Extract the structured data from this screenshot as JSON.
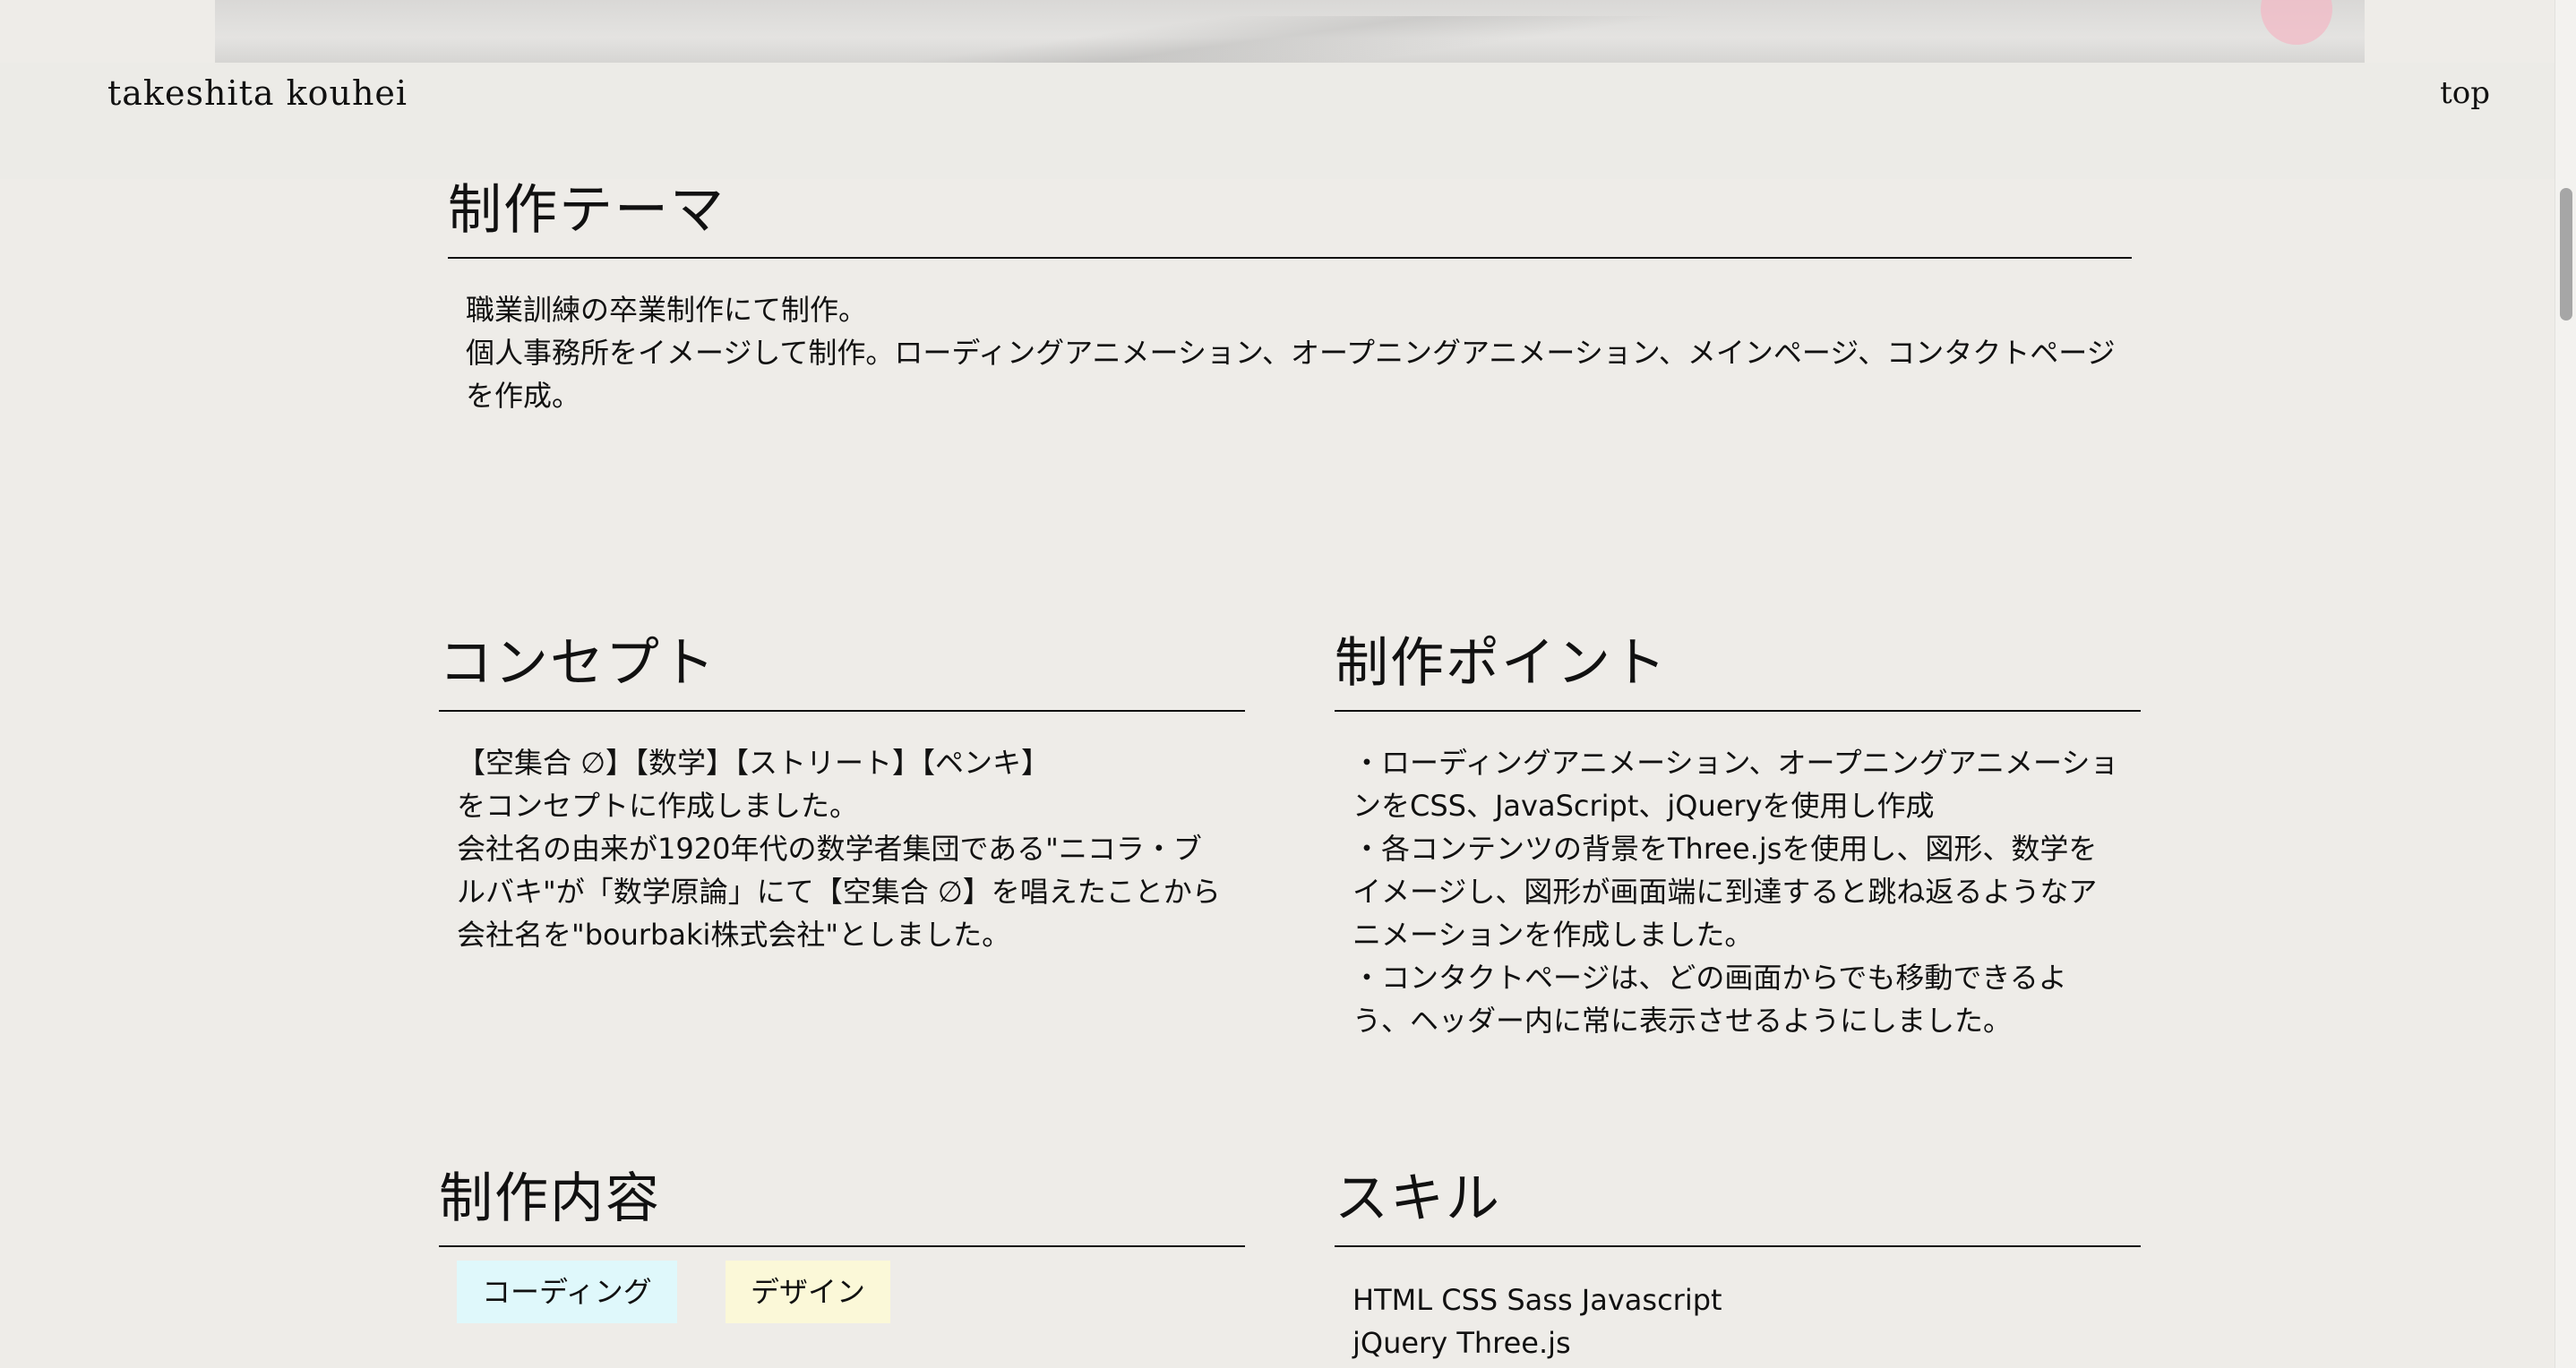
{
  "header": {
    "site_title": "takeshita kouhei",
    "nav_top": "top"
  },
  "theme": {
    "heading": "制作テーマ",
    "lines": [
      "職業訓練の卒業制作にて制作。",
      "個人事務所をイメージして制作。ローディングアニメーション、オープニングアニメーション、メインページ、コンタクトページ",
      "を作成。"
    ]
  },
  "concept": {
    "heading": "コンセプト",
    "lines": [
      "【空集合 ∅】【数学】【ストリート】【ペンキ】",
      "をコンセプトに作成しました。",
      "会社名の由来が1920年代の数学者集団である\"ニコラ・ブ",
      "ルバキ\"が「数学原論」にて【空集合 ∅】を唱えたことから",
      "会社名を\"bourbaki株式会社\"としました。"
    ]
  },
  "points": {
    "heading": "制作ポイント",
    "lines": [
      "・ローディングアニメーション、オープニングアニメーショ",
      "ンをCSS、JavaScript、jQueryを使用し作成",
      "・各コンテンツの背景をThree.jsを使用し、図形、数学を",
      "イメージし、図形が画面端に到達すると跳ね返るようなア",
      "ニメーションを作成しました。",
      "・コンタクトページは、どの画面からでも移動できるよ",
      "う、ヘッダー内に常に表示させるようにしました。"
    ]
  },
  "contents": {
    "heading": "制作内容",
    "tags": [
      "コーディング",
      "デザイン"
    ]
  },
  "skills": {
    "heading": "スキル",
    "lines": [
      "HTML CSS Sass Javascript",
      "jQuery Three.js"
    ]
  }
}
